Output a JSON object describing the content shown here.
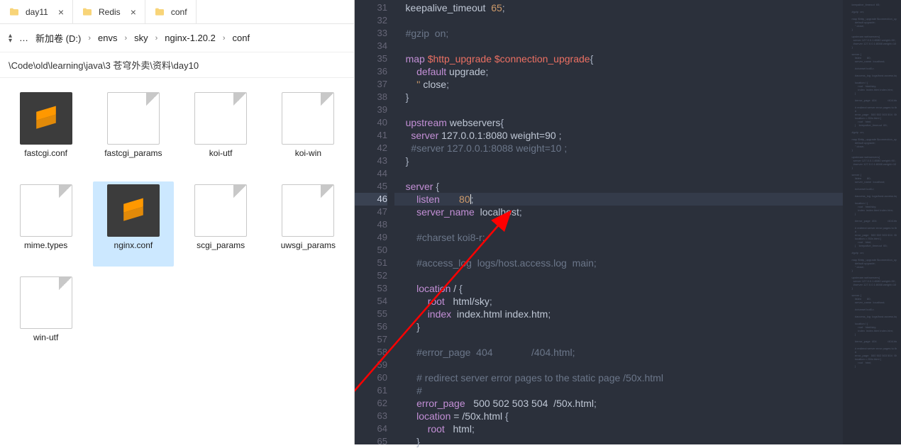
{
  "explorer": {
    "tabs": [
      {
        "label": "day11",
        "icon": "folder",
        "closable": true
      },
      {
        "label": "Redis",
        "icon": "folder",
        "closable": true
      },
      {
        "label": "conf",
        "icon": "folder",
        "closable": false,
        "active": true
      }
    ],
    "breadcrumb": {
      "dots": "…",
      "items": [
        "新加卷 (D:)",
        "envs",
        "sky",
        "nginx-1.20.2",
        "conf"
      ]
    },
    "path": "\\Code\\old\\learning\\java\\3 苍穹外卖\\资料\\day10",
    "files": [
      {
        "label": "fastcgi.conf",
        "icon": "sublime"
      },
      {
        "label": "fastcgi_params",
        "icon": "generic"
      },
      {
        "label": "koi-utf",
        "icon": "generic"
      },
      {
        "label": "koi-win",
        "icon": "generic"
      },
      {
        "label": "mime.types",
        "icon": "generic"
      },
      {
        "label": "nginx.conf",
        "icon": "sublime",
        "selected": true
      },
      {
        "label": "scgi_params",
        "icon": "generic"
      },
      {
        "label": "uwsgi_params",
        "icon": "generic"
      },
      {
        "label": "win-utf",
        "icon": "generic"
      }
    ]
  },
  "editor": {
    "first_line_no": 31,
    "highlight_line_no": 46,
    "lines": [
      [
        [
          "plain",
          "    keepalive_timeout  "
        ],
        [
          "num",
          "65"
        ],
        [
          "punc",
          ";"
        ]
      ],
      [],
      [
        [
          "plain",
          "    "
        ],
        [
          "com",
          "#gzip  on;"
        ]
      ],
      [],
      [
        [
          "plain",
          "    "
        ],
        [
          "key",
          "map"
        ],
        [
          "plain",
          " "
        ],
        [
          "var",
          "$http_upgrade"
        ],
        [
          "plain",
          " "
        ],
        [
          "var",
          "$connection_upgrade"
        ],
        [
          "punc",
          "{"
        ]
      ],
      [
        [
          "plain",
          "        "
        ],
        [
          "key",
          "default"
        ],
        [
          "plain",
          " upgrade"
        ],
        [
          "punc",
          ";"
        ]
      ],
      [
        [
          "plain",
          "        "
        ],
        [
          "str",
          "''"
        ],
        [
          "plain",
          " close"
        ],
        [
          "punc",
          ";"
        ]
      ],
      [
        [
          "plain",
          "    "
        ],
        [
          "punc",
          "}"
        ]
      ],
      [],
      [
        [
          "plain",
          "    "
        ],
        [
          "key",
          "upstream"
        ],
        [
          "plain",
          " webservers"
        ],
        [
          "punc",
          "{"
        ]
      ],
      [
        [
          "plain",
          "      "
        ],
        [
          "key",
          "server"
        ],
        [
          "plain",
          " 127.0.0.1:8080 weight=90 "
        ],
        [
          "punc",
          ";"
        ]
      ],
      [
        [
          "plain",
          "      "
        ],
        [
          "com",
          "#server 127.0.0.1:8088 weight=10 ;"
        ]
      ],
      [
        [
          "plain",
          "    "
        ],
        [
          "punc",
          "}"
        ]
      ],
      [],
      [
        [
          "plain",
          "    "
        ],
        [
          "key",
          "server"
        ],
        [
          "plain",
          " "
        ],
        [
          "punc",
          "{"
        ]
      ],
      [
        [
          "plain",
          "        "
        ],
        [
          "key",
          "listen"
        ],
        [
          "plain",
          "       "
        ],
        [
          "num",
          "80"
        ],
        [
          "caret",
          ""
        ],
        [
          "punc",
          ";"
        ]
      ],
      [
        [
          "plain",
          "        "
        ],
        [
          "key",
          "server_name"
        ],
        [
          "plain",
          "  localhost"
        ],
        [
          "punc",
          ";"
        ]
      ],
      [],
      [
        [
          "plain",
          "        "
        ],
        [
          "com",
          "#charset koi8-r;"
        ]
      ],
      [],
      [
        [
          "plain",
          "        "
        ],
        [
          "com",
          "#access_log  logs/host.access.log  main;"
        ]
      ],
      [],
      [
        [
          "plain",
          "        "
        ],
        [
          "key",
          "location"
        ],
        [
          "plain",
          " / "
        ],
        [
          "punc",
          "{"
        ]
      ],
      [
        [
          "plain",
          "            "
        ],
        [
          "key",
          "root"
        ],
        [
          "plain",
          "   html/sky"
        ],
        [
          "punc",
          ";"
        ]
      ],
      [
        [
          "plain",
          "            "
        ],
        [
          "key",
          "index"
        ],
        [
          "plain",
          "  index.html index.htm"
        ],
        [
          "punc",
          ";"
        ]
      ],
      [
        [
          "plain",
          "        "
        ],
        [
          "punc",
          "}"
        ]
      ],
      [],
      [
        [
          "plain",
          "        "
        ],
        [
          "com",
          "#error_page  404              /404.html;"
        ]
      ],
      [],
      [
        [
          "plain",
          "        "
        ],
        [
          "com",
          "# redirect server error pages to the static page /50x.html"
        ]
      ],
      [
        [
          "plain",
          "        "
        ],
        [
          "com",
          "#"
        ]
      ],
      [
        [
          "plain",
          "        "
        ],
        [
          "key",
          "error_page"
        ],
        [
          "plain",
          "   500 502 503 504  /50x.html"
        ],
        [
          "punc",
          ";"
        ]
      ],
      [
        [
          "plain",
          "        "
        ],
        [
          "key",
          "location"
        ],
        [
          "plain",
          " = /50x.html "
        ],
        [
          "punc",
          "{"
        ]
      ],
      [
        [
          "plain",
          "            "
        ],
        [
          "key",
          "root"
        ],
        [
          "plain",
          "   html"
        ],
        [
          "punc",
          ";"
        ]
      ],
      [
        [
          "plain",
          "        "
        ],
        [
          "punc",
          "}"
        ]
      ]
    ]
  }
}
